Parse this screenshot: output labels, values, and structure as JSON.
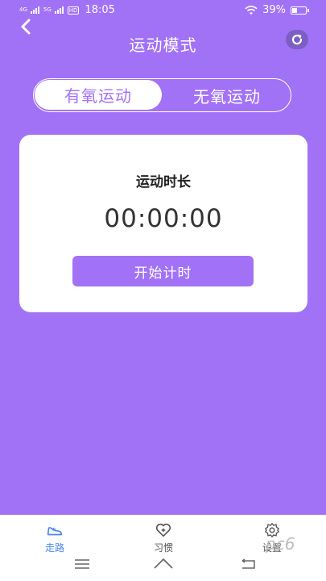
{
  "status_bar": {
    "signal1_label": "4G",
    "signal2_label": "5G",
    "hd_label": "HD",
    "time": "18:05",
    "battery_percent": "39%"
  },
  "header": {
    "title": "运动模式"
  },
  "mode_tabs": [
    {
      "label": "有氧运动",
      "active": true
    },
    {
      "label": "无氧运动",
      "active": false
    }
  ],
  "timer_card": {
    "title": "运动时长",
    "time": "00:00:00",
    "start_label": "开始计时"
  },
  "bottom_nav": {
    "items": [
      {
        "label": "走路",
        "icon": "shoe-icon",
        "active": true
      },
      {
        "label": "习惯",
        "icon": "heart-plus-icon",
        "active": false
      },
      {
        "label": "设置",
        "icon": "gear-icon",
        "active": false
      }
    ]
  },
  "watermark": "pc6",
  "colors": {
    "background": "#a272f6",
    "accent": "#a272f6",
    "active_nav": "#4a86e8"
  }
}
